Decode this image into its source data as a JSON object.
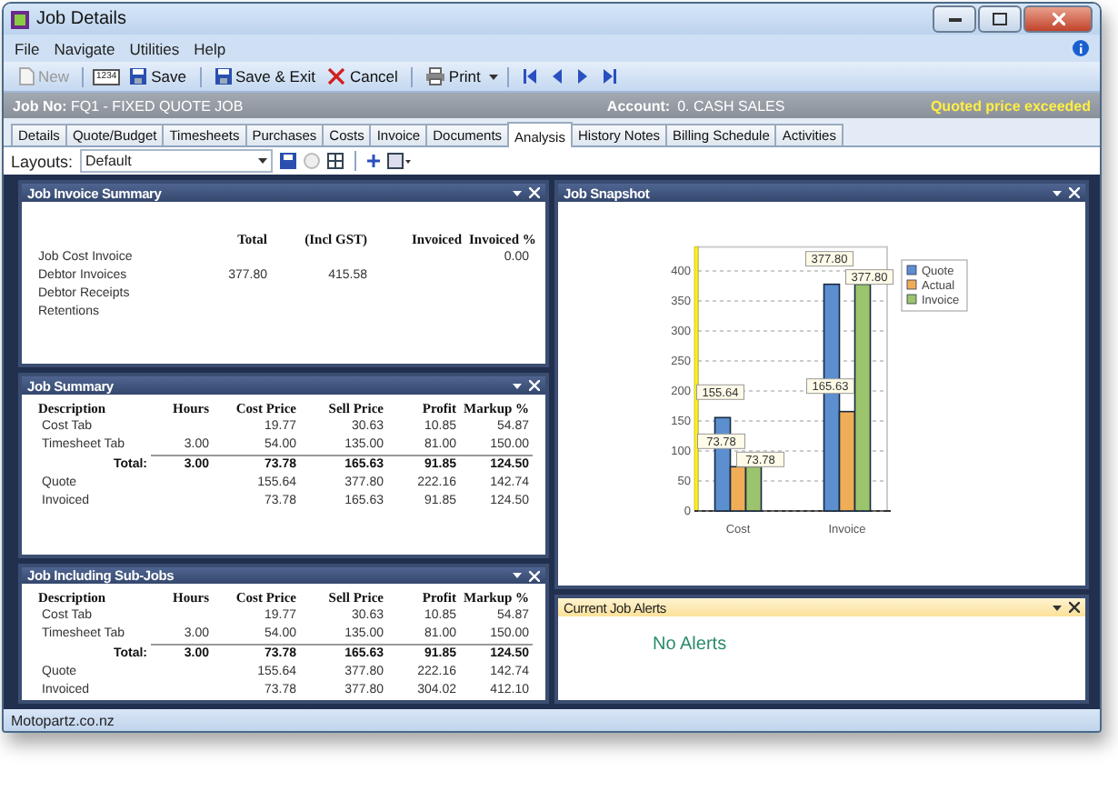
{
  "window": {
    "title": "Job Details"
  },
  "menu": [
    "File",
    "Navigate",
    "Utilities",
    "Help"
  ],
  "toolbar": [
    {
      "kind": "new",
      "label": "New",
      "disabled": true
    },
    {
      "kind": "numbering",
      "label": "1234",
      "disabled": false
    },
    {
      "kind": "save",
      "label": "Save",
      "disabled": false
    },
    {
      "kind": "save-exit",
      "label": "Save & Exit",
      "disabled": false
    },
    {
      "kind": "cancel",
      "label": "Cancel",
      "disabled": false
    },
    {
      "kind": "print",
      "label": "Print",
      "disabled": false
    },
    {
      "kind": "first",
      "disabled": false
    },
    {
      "kind": "prev",
      "disabled": false
    },
    {
      "kind": "next",
      "disabled": false
    },
    {
      "kind": "last",
      "disabled": false
    }
  ],
  "job_bar": {
    "job_label": "Job No:",
    "job_value": "FQ1 - FIXED QUOTE JOB",
    "account_label": "Account:",
    "account_value": "0. CASH SALES",
    "warning": "Quoted price exceeded"
  },
  "tabs": [
    {
      "label": "Details",
      "selected": false
    },
    {
      "label": "Quote/Budget",
      "selected": false
    },
    {
      "label": "Timesheets",
      "selected": false
    },
    {
      "label": "Purchases",
      "selected": false
    },
    {
      "label": "Costs",
      "selected": false
    },
    {
      "label": "Invoice",
      "selected": false
    },
    {
      "label": "Documents",
      "selected": false
    },
    {
      "label": "Analysis",
      "selected": true
    },
    {
      "label": "History Notes",
      "selected": false
    },
    {
      "label": "Billing Schedule",
      "selected": false
    },
    {
      "label": "Activities",
      "selected": false
    }
  ],
  "layouts": {
    "label": "Layouts:",
    "value": "Default"
  },
  "invoice_summary": {
    "title": "Job Invoice Summary",
    "columns": [
      null,
      "Total",
      "(Incl GST)",
      "Invoiced",
      "Invoiced %"
    ],
    "rows": [
      {
        "cells": [
          "Job Cost Invoice",
          null,
          null,
          null,
          "0.00"
        ]
      },
      {
        "cells": [
          "Debtor Invoices",
          "377.80",
          "415.58",
          null,
          null
        ]
      },
      {
        "cells": [
          "Debtor Receipts",
          null,
          null,
          null,
          null
        ]
      },
      {
        "cells": [
          "Retentions",
          null,
          null,
          null,
          null
        ]
      }
    ]
  },
  "job_summary": {
    "title": "Job Summary",
    "columns": [
      "Description",
      "Hours",
      "Cost Price",
      "Sell Price",
      "Profit",
      "Markup %"
    ],
    "rows": [
      {
        "kind": "row",
        "cells": [
          "Cost Tab",
          null,
          "19.77",
          "30.63",
          "10.85",
          "54.87"
        ]
      },
      {
        "kind": "row",
        "cells": [
          "Timesheet Tab",
          "3.00",
          "54.00",
          "135.00",
          "81.00",
          "150.00"
        ]
      },
      {
        "kind": "total",
        "cells": [
          "Total:",
          "3.00",
          "73.78",
          "165.63",
          "91.85",
          "124.50"
        ]
      },
      {
        "kind": "row",
        "cells": [
          "Quote",
          null,
          "155.64",
          "377.80",
          "222.16",
          "142.74"
        ]
      },
      {
        "kind": "row",
        "cells": [
          "Invoiced",
          null,
          "73.78",
          "165.63",
          "91.85",
          "124.50"
        ]
      }
    ]
  },
  "sub_jobs": {
    "title": "Job Including Sub-Jobs",
    "columns": [
      "Description",
      "Hours",
      "Cost Price",
      "Sell Price",
      "Profit",
      "Markup %"
    ],
    "rows": [
      {
        "kind": "row",
        "cells": [
          "Cost Tab",
          null,
          "19.77",
          "30.63",
          "10.85",
          "54.87"
        ]
      },
      {
        "kind": "row",
        "cells": [
          "Timesheet Tab",
          "3.00",
          "54.00",
          "135.00",
          "81.00",
          "150.00"
        ]
      },
      {
        "kind": "total",
        "cells": [
          "Total:",
          "3.00",
          "73.78",
          "165.63",
          "91.85",
          "124.50"
        ]
      },
      {
        "kind": "row",
        "cells": [
          "Quote",
          null,
          "155.64",
          "377.80",
          "222.16",
          "142.74"
        ]
      },
      {
        "kind": "row",
        "cells": [
          "Invoiced",
          null,
          "73.78",
          "377.80",
          "304.02",
          "412.10"
        ]
      }
    ]
  },
  "snapshot": {
    "title": "Job Snapshot",
    "chart_data": {
      "type": "bar",
      "categories": [
        "Cost",
        "Invoice"
      ],
      "series": [
        {
          "name": "Quote",
          "color": "#5b8fd0",
          "values": [
            155.64,
            377.8
          ],
          "value_labels": [
            "155.64",
            "377.80"
          ]
        },
        {
          "name": "Actual",
          "color": "#f0ad58",
          "values": [
            73.78,
            165.63
          ],
          "value_labels": [
            "73.78",
            "165.63"
          ]
        },
        {
          "name": "Invoice",
          "color": "#9cc46c",
          "values": [
            73.78,
            377.8
          ],
          "value_labels": [
            "73.78",
            "377.80"
          ]
        }
      ],
      "ylim": [
        0,
        440
      ],
      "yticks": [
        0,
        50,
        100,
        150,
        200,
        250,
        300,
        350,
        400
      ],
      "grid": true,
      "legend": true
    }
  },
  "alerts": {
    "title": "Current Job Alerts",
    "message": "No Alerts"
  },
  "status_bar": "Motopartz.co.nz"
}
